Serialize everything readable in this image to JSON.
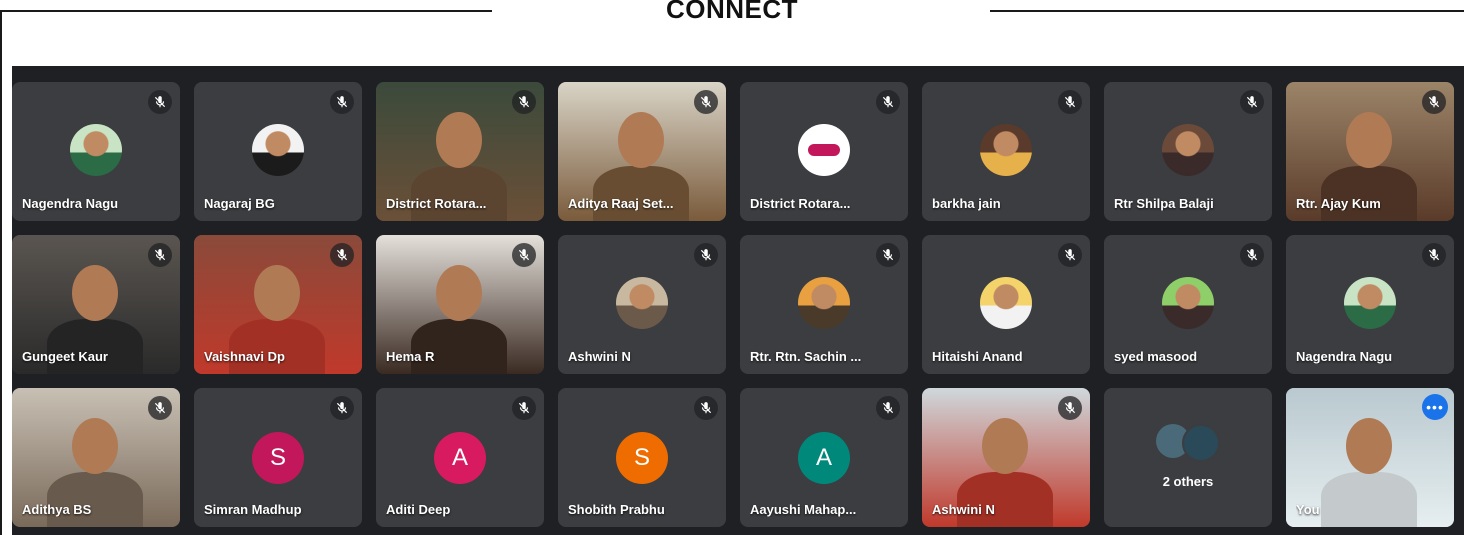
{
  "header": {
    "title": "CONNECT"
  },
  "colors": {
    "grid_bg": "#1f2023",
    "tile_bg": "#3b3d40",
    "selected_outline": "#8ab4f8"
  },
  "participants": [
    {
      "name": "Nagendra Nagu",
      "kind": "photo",
      "colors": [
        "#c9e3c5",
        "#2b6b45"
      ]
    },
    {
      "name": "Nagaraj BG",
      "kind": "photo",
      "colors": [
        "#f2f2f2",
        "#1b1b1b"
      ]
    },
    {
      "name": "District Rotara...",
      "kind": "video",
      "colors": [
        "#3b4a3b",
        "#6b5038"
      ]
    },
    {
      "name": "Aditya Raaj Set...",
      "kind": "video",
      "colors": [
        "#d9d4c7",
        "#7a5b3b"
      ]
    },
    {
      "name": "District Rotara...",
      "kind": "logo",
      "colors": [
        "#ffffff",
        "#c2185b"
      ]
    },
    {
      "name": "barkha jain",
      "kind": "photo",
      "colors": [
        "#5a3a2a",
        "#e6b04a"
      ]
    },
    {
      "name": "Rtr Shilpa Balaji",
      "kind": "photo",
      "colors": [
        "#6b4a3a",
        "#3a2a2a"
      ]
    },
    {
      "name": "Rtr. Ajay Kum",
      "kind": "video",
      "colors": [
        "#9b8468",
        "#5a3b2a"
      ]
    },
    {
      "name": "Gungeet Kaur",
      "kind": "video",
      "colors": [
        "#5a5550",
        "#2a2a2a"
      ]
    },
    {
      "name": "Vaishnavi Dp",
      "kind": "video",
      "colors": [
        "#8a4a3a",
        "#c0392b"
      ]
    },
    {
      "name": "Hema R",
      "kind": "video",
      "colors": [
        "#e4e0da",
        "#3a2a22"
      ]
    },
    {
      "name": "Ashwini N",
      "kind": "photo",
      "colors": [
        "#c9b8a0",
        "#6b5a4a"
      ]
    },
    {
      "name": "Rtr. Rtn. Sachin ...",
      "kind": "photo",
      "colors": [
        "#e8a040",
        "#4a3a2a"
      ]
    },
    {
      "name": "Hitaishi Anand",
      "kind": "photo",
      "colors": [
        "#f3d36a",
        "#f2f2f2"
      ]
    },
    {
      "name": "syed masood",
      "kind": "photo",
      "colors": [
        "#8fcf6a",
        "#3a2a2a"
      ]
    },
    {
      "name": "Nagendra Nagu",
      "kind": "photo",
      "colors": [
        "#c9e3c5",
        "#2b6b45"
      ]
    },
    {
      "name": "Adithya BS",
      "kind": "video",
      "colors": [
        "#c8c0b4",
        "#7a6a5a"
      ]
    },
    {
      "name": "Simran Madhup",
      "kind": "letter",
      "letter": "S",
      "colors": [
        "#c2185b"
      ]
    },
    {
      "name": "Aditi Deep",
      "kind": "letter",
      "letter": "A",
      "colors": [
        "#d81b60"
      ]
    },
    {
      "name": "Shobith Prabhu",
      "kind": "letter",
      "letter": "S",
      "colors": [
        "#ef6c00"
      ]
    },
    {
      "name": "Aayushi Mahap...",
      "kind": "letter",
      "letter": "A",
      "colors": [
        "#00897b"
      ]
    },
    {
      "name": "Ashwini N",
      "kind": "video",
      "colors": [
        "#cfd8dc",
        "#c0392b"
      ]
    },
    {
      "name": "2 others",
      "kind": "others",
      "colors": [
        "#4a6a7a",
        "#2a4a5a"
      ]
    },
    {
      "name": "You",
      "kind": "self",
      "colors": [
        "#b9c9cf",
        "#e6eef0"
      ]
    }
  ]
}
